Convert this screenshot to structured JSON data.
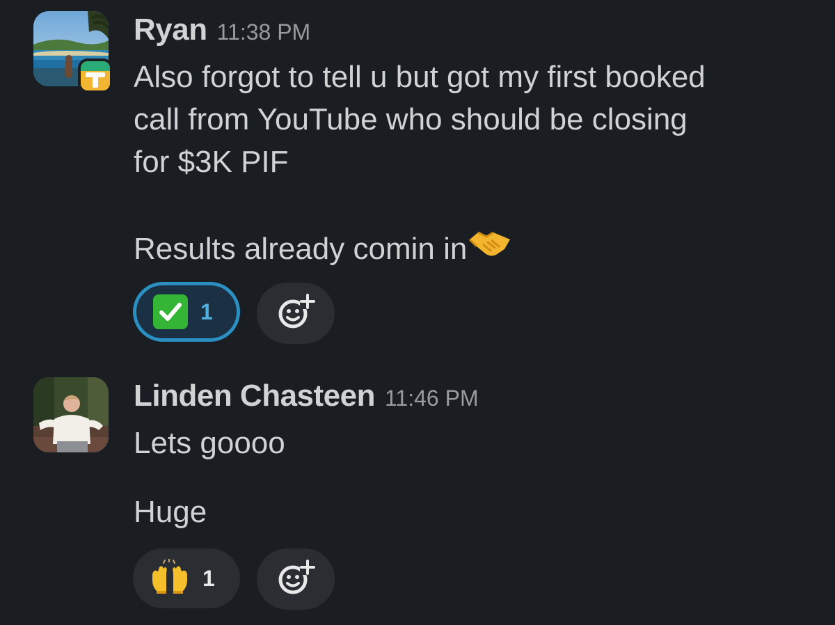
{
  "messages": [
    {
      "author": "Ryan",
      "time": "11:38 PM",
      "lines": [
        "Also forgot to tell u but got my first booked",
        "call from YouTube who should be closing",
        "for $3K PIF",
        "Results already comin in"
      ],
      "trailing_emoji": "handshake-icon",
      "reactions": [
        {
          "emoji": "white-check-mark-icon",
          "count": "1",
          "reacted_by_me": true
        }
      ]
    },
    {
      "author": "Linden Chasteen",
      "time": "11:46 PM",
      "lines": [
        "Lets goooo",
        "Huge"
      ],
      "reactions": [
        {
          "emoji": "raised-hands-icon",
          "count": "1",
          "reacted_by_me": false
        }
      ]
    }
  ],
  "colors": {
    "background": "#1a1d21",
    "text": "#d1d2d3",
    "timestamp": "#9a9b9d",
    "reaction_active_border": "#2b8fc2",
    "reaction_active_bg": "#1b3143",
    "reaction_bg": "#2a2d31"
  }
}
